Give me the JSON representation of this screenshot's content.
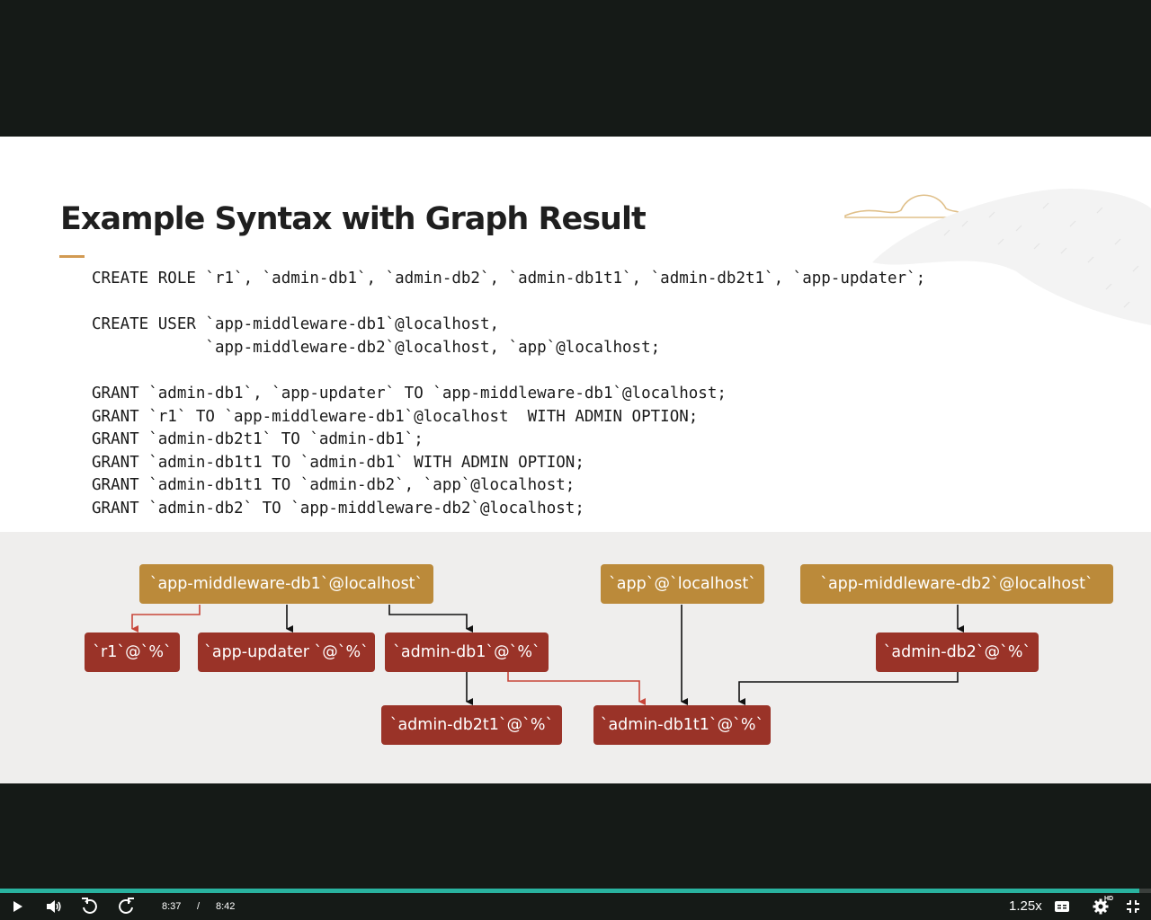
{
  "slide": {
    "title": "Example Syntax with Graph Result",
    "code_lines": [
      "CREATE ROLE `r1`, `admin-db1`, `admin-db2`, `admin-db1t1`, `admin-db2t1`, `app-updater`;",
      "",
      "CREATE USER `app-middleware-db1`@localhost,",
      "            `app-middleware-db2`@localhost, `app`@localhost;",
      "",
      "GRANT `admin-db1`, `app-updater` TO `app-middleware-db1`@localhost;",
      "GRANT `r1` TO `app-middleware-db1`@localhost  WITH ADMIN OPTION;",
      "GRANT `admin-db2t1` TO `admin-db1`;",
      "GRANT `admin-db1t1 TO `admin-db1` WITH ADMIN OPTION;",
      "GRANT `admin-db1t1 TO `admin-db2`, `app`@localhost;",
      "GRANT `admin-db2` TO `app-middleware-db2`@localhost;"
    ]
  },
  "graph": {
    "nodes": {
      "user_mw_db1": "`app-middleware-db1`@localhost`",
      "user_app": "`app`@`localhost`",
      "user_mw_db2": "`app-middleware-db2`@localhost`",
      "role_r1": "`r1`@`%`",
      "role_app_updater": "`app-updater `@`%`",
      "role_admin_db1": "`admin-db1`@`%`",
      "role_admin_db2": "`admin-db2`@`%`",
      "role_admin_db2t1": "`admin-db2t1`@`%`",
      "role_admin_db1t1": "`admin-db1t1`@`%`"
    },
    "colors": {
      "user_node": "#bb8a3a",
      "role_node": "#9a3328",
      "grant_edge": "#111111",
      "admin_option_edge": "#c8463a"
    }
  },
  "player": {
    "current_time": "8:37",
    "separator": "/",
    "duration": "8:42",
    "progress_fraction": 0.99,
    "speed": "1.25x",
    "quality_badge": "HD",
    "icons": [
      "play-icon",
      "volume-icon",
      "rewind-icon",
      "forward-icon",
      "captions-icon",
      "settings-icon",
      "exit-fullscreen-icon"
    ]
  }
}
